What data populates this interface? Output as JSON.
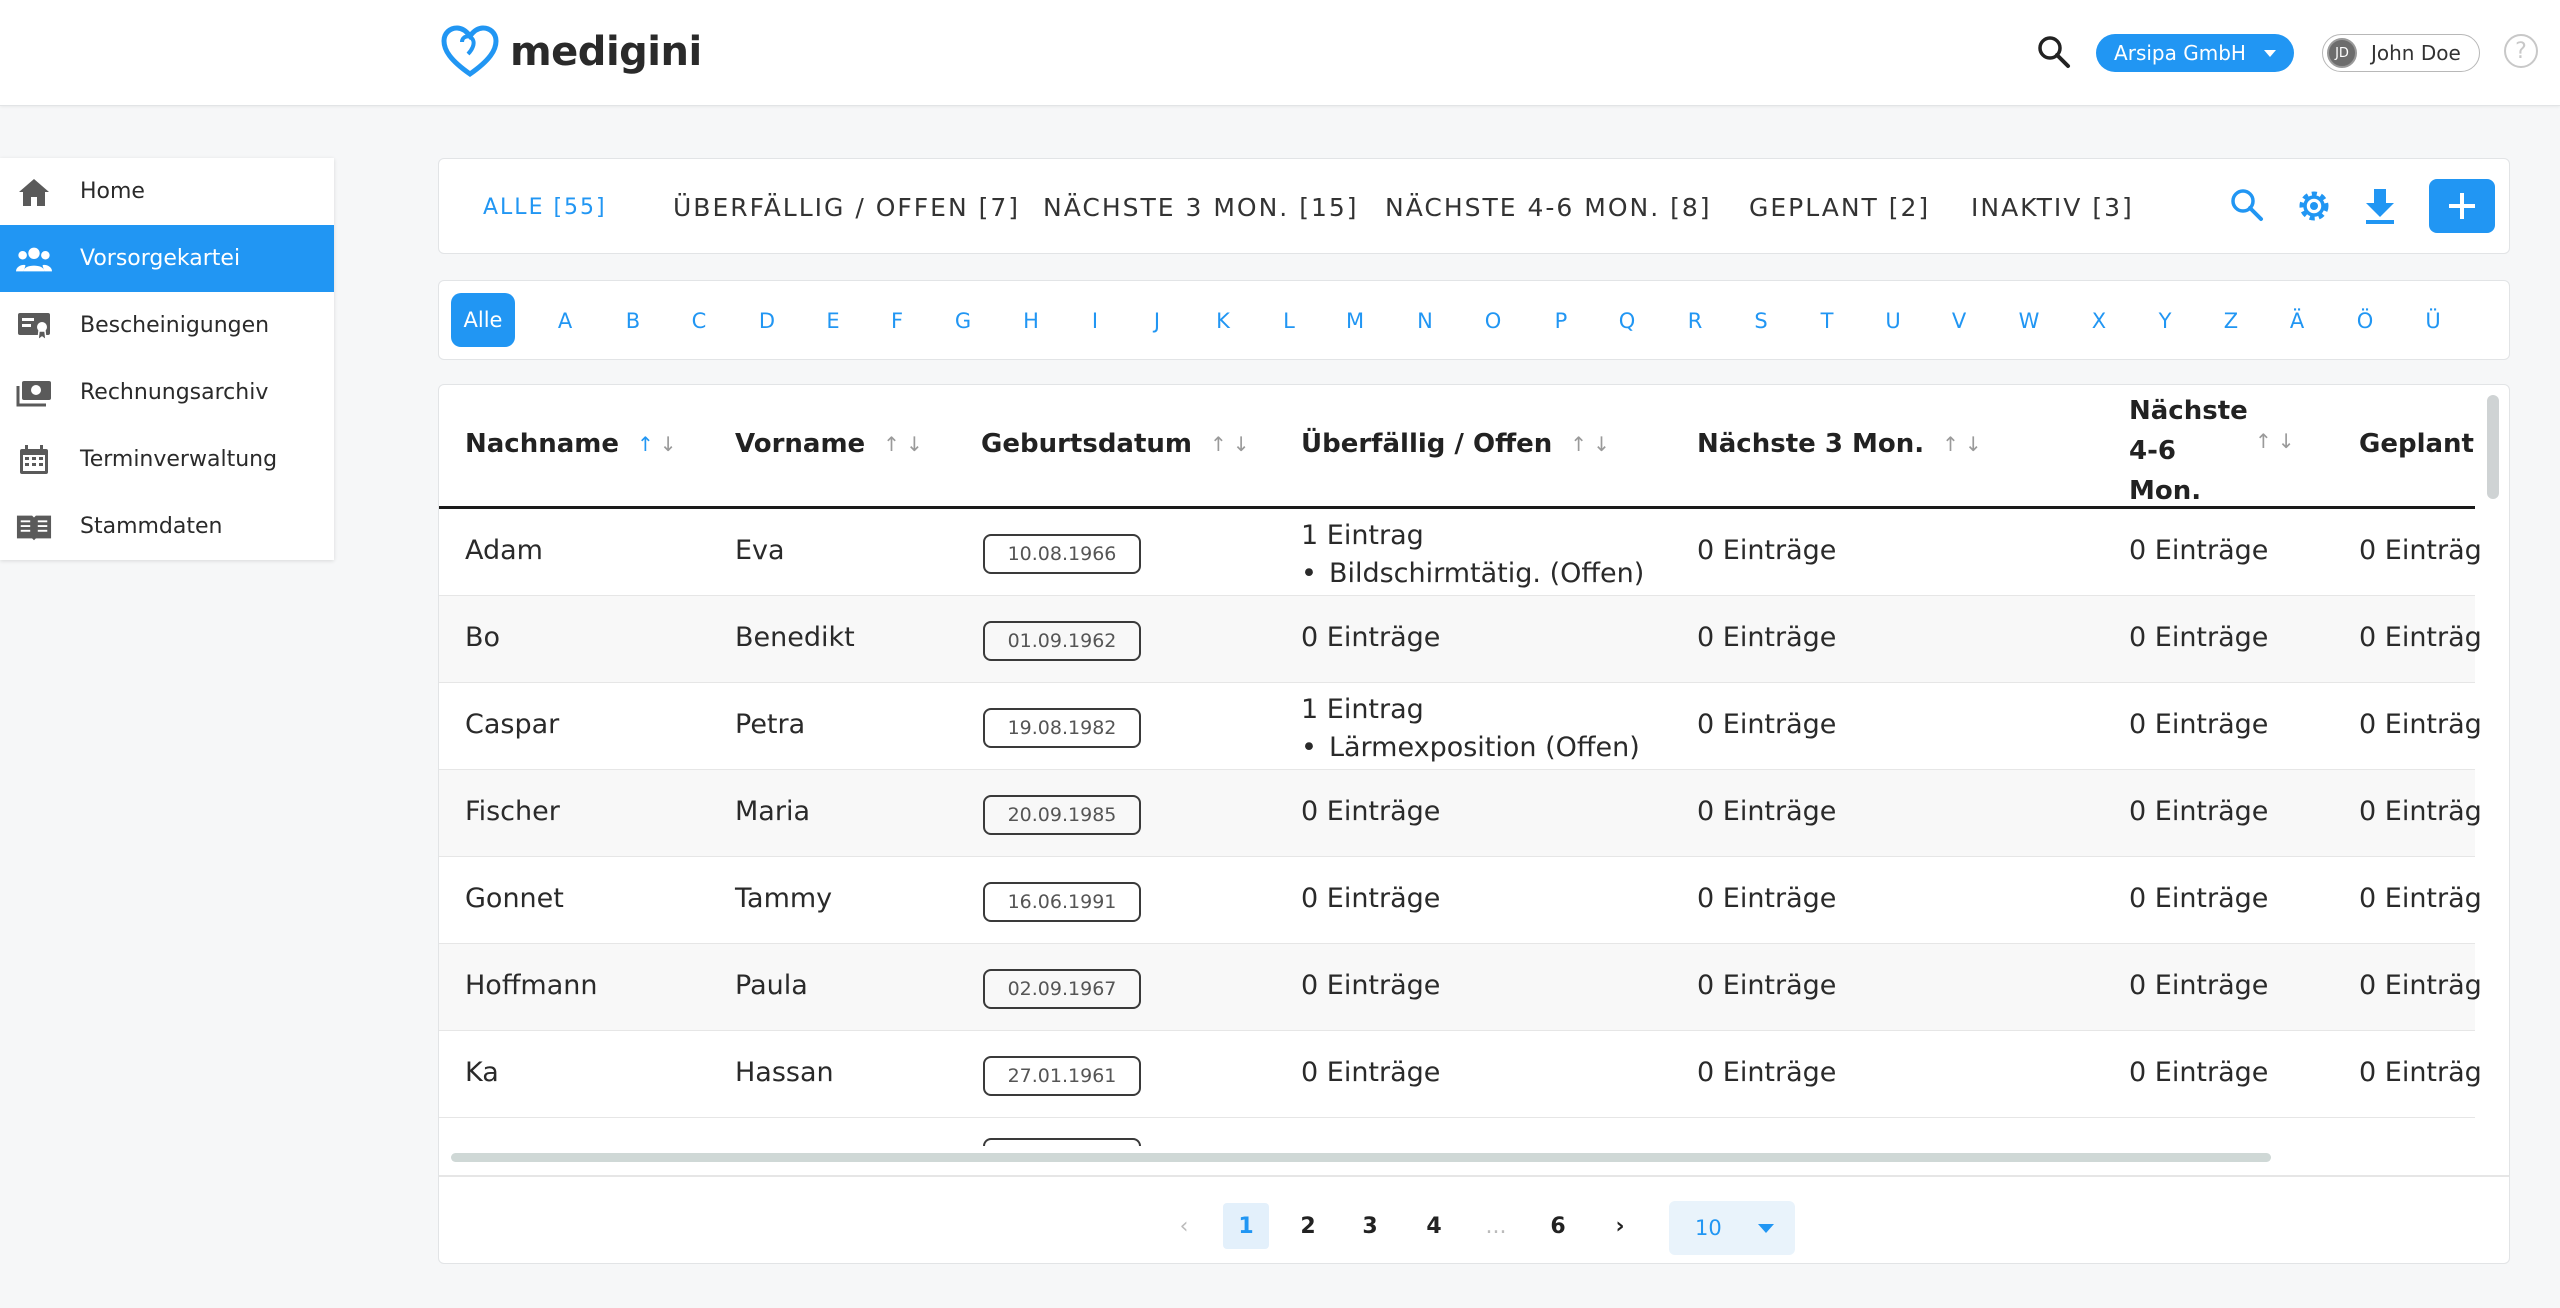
{
  "header": {
    "logo_text": "medigini",
    "company": "Arsipa GmbH",
    "user_initials": "JD",
    "user_name": "John Doe",
    "help": "?"
  },
  "sidebar": {
    "items": [
      {
        "label": "Home",
        "icon": "home-icon"
      },
      {
        "label": "Vorsorgekartei",
        "icon": "people-icon"
      },
      {
        "label": "Bescheinigungen",
        "icon": "certificate-icon"
      },
      {
        "label": "Rechnungsarchiv",
        "icon": "money-icon"
      },
      {
        "label": "Terminverwaltung",
        "icon": "calendar-icon"
      },
      {
        "label": "Stammdaten",
        "icon": "book-icon"
      }
    ]
  },
  "tabs": [
    {
      "label": "ALLE [55]"
    },
    {
      "label": "ÜBERFÄLLIG / OFFEN [7]"
    },
    {
      "label": "NÄCHSTE 3 MON. [15]"
    },
    {
      "label": "NÄCHSTE 4-6 MON. [8]"
    },
    {
      "label": "GEPLANT [2]"
    },
    {
      "label": "INAKTIV [3]"
    }
  ],
  "alphabet": [
    "Alle",
    "A",
    "B",
    "C",
    "D",
    "E",
    "F",
    "G",
    "H",
    "I",
    "J",
    "K",
    "L",
    "M",
    "N",
    "O",
    "P",
    "Q",
    "R",
    "S",
    "T",
    "U",
    "V",
    "W",
    "X",
    "Y",
    "Z",
    "Ä",
    "Ö",
    "Ü"
  ],
  "table": {
    "headers": {
      "nachname": "Nachname",
      "vorname": "Vorname",
      "geburtsdatum": "Geburtsdatum",
      "ueberfaellig": "Überfällig / Offen",
      "naechste3": "Nächste 3 Mon.",
      "naechste46_l1": "Nächste",
      "naechste46_l2": "4-6",
      "naechste46_l3": "Mon.",
      "geplant": "Geplant"
    },
    "rows": [
      {
        "nachname": "Adam",
        "vorname": "Eva",
        "geburtsdatum": "10.08.1966",
        "ueberfaellig": "1 Eintrag",
        "detail": "Bildschirmtätig. (Offen)",
        "naechste3": "0 Einträge",
        "naechste46": "0 Einträge",
        "geplant": "0 Einträg"
      },
      {
        "nachname": "Bo",
        "vorname": "Benedikt",
        "geburtsdatum": "01.09.1962",
        "ueberfaellig": "0 Einträge",
        "detail": "",
        "naechste3": "0 Einträge",
        "naechste46": "0 Einträge",
        "geplant": "0 Einträg"
      },
      {
        "nachname": "Caspar",
        "vorname": "Petra",
        "geburtsdatum": "19.08.1982",
        "ueberfaellig": "1 Eintrag",
        "detail": "Lärmexposition (Offen)",
        "naechste3": "0 Einträge",
        "naechste46": "0 Einträge",
        "geplant": "0 Einträg"
      },
      {
        "nachname": "Fischer",
        "vorname": "Maria",
        "geburtsdatum": "20.09.1985",
        "ueberfaellig": "0 Einträge",
        "detail": "",
        "naechste3": "0 Einträge",
        "naechste46": "0 Einträge",
        "geplant": "0 Einträg"
      },
      {
        "nachname": "Gonnet",
        "vorname": "Tammy",
        "geburtsdatum": "16.06.1991",
        "ueberfaellig": "0 Einträge",
        "detail": "",
        "naechste3": "0 Einträge",
        "naechste46": "0 Einträge",
        "geplant": "0 Einträg"
      },
      {
        "nachname": "Hoffmann",
        "vorname": "Paula",
        "geburtsdatum": "02.09.1967",
        "ueberfaellig": "0 Einträge",
        "detail": "",
        "naechste3": "0 Einträge",
        "naechste46": "0 Einträge",
        "geplant": "0 Einträg"
      },
      {
        "nachname": "Ka",
        "vorname": "Hassan",
        "geburtsdatum": "27.01.1961",
        "ueberfaellig": "0 Einträge",
        "detail": "",
        "naechste3": "0 Einträge",
        "naechste46": "0 Einträge",
        "geplant": "0 Einträg"
      }
    ]
  },
  "pagination": {
    "prev": "‹",
    "pages": [
      "1",
      "2",
      "3",
      "4",
      "...",
      "6"
    ],
    "next": "›",
    "current": "1",
    "page_size": "10"
  },
  "colors": {
    "accent": "#2196f3"
  }
}
